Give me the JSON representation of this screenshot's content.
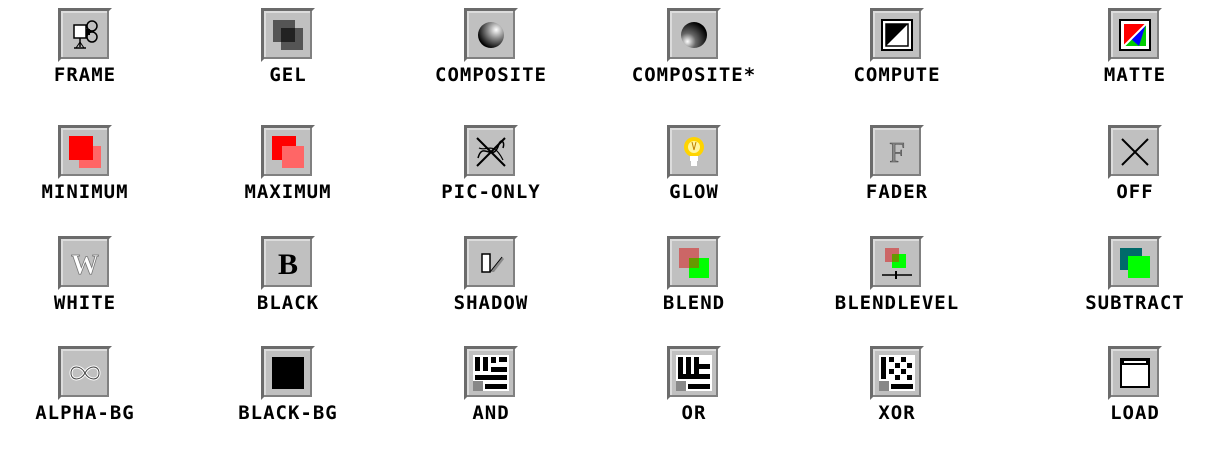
{
  "buttons": [
    {
      "label": "FRAME",
      "icon": "film-camera-icon"
    },
    {
      "label": "GEL",
      "icon": "overlapping-squares-icon"
    },
    {
      "label": "COMPOSITE",
      "icon": "shaded-sphere-icon"
    },
    {
      "label": "COMPOSITE*",
      "icon": "dark-sphere-icon"
    },
    {
      "label": "COMPUTE",
      "icon": "diagonal-split-square-icon"
    },
    {
      "label": "MATTE",
      "icon": "color-matte-icon"
    },
    {
      "label": "MINIMUM",
      "icon": "minimum-squares-icon"
    },
    {
      "label": "MAXIMUM",
      "icon": "maximum-squares-icon"
    },
    {
      "label": "PIC-ONLY",
      "icon": "crossed-out-scribble-icon"
    },
    {
      "label": "GLOW",
      "icon": "lightbulb-glow-icon"
    },
    {
      "label": "FADER",
      "icon": "letter-f-icon"
    },
    {
      "label": "OFF",
      "icon": "x-cross-icon"
    },
    {
      "label": "WHITE",
      "icon": "letter-w-icon"
    },
    {
      "label": "BLACK",
      "icon": "letter-b-icon"
    },
    {
      "label": "SHADOW",
      "icon": "shadow-shape-icon"
    },
    {
      "label": "BLEND",
      "icon": "blend-squares-icon"
    },
    {
      "label": "BLENDLEVEL",
      "icon": "blend-level-slider-icon"
    },
    {
      "label": "SUBTRACT",
      "icon": "subtract-squares-icon"
    },
    {
      "label": "ALPHA-BG",
      "icon": "alpha-loop-icon"
    },
    {
      "label": "BLACK-BG",
      "icon": "black-square-icon"
    },
    {
      "label": "AND",
      "icon": "and-pattern-icon"
    },
    {
      "label": "OR",
      "icon": "or-pattern-icon"
    },
    {
      "label": "XOR",
      "icon": "xor-pattern-icon"
    },
    {
      "label": "LOAD",
      "icon": "window-icon"
    }
  ],
  "colors": {
    "button_face": "#c0c0c0",
    "red": "#ff0000",
    "pink": "#ff6666",
    "green": "#00ff00",
    "teal": "#006a6a"
  }
}
